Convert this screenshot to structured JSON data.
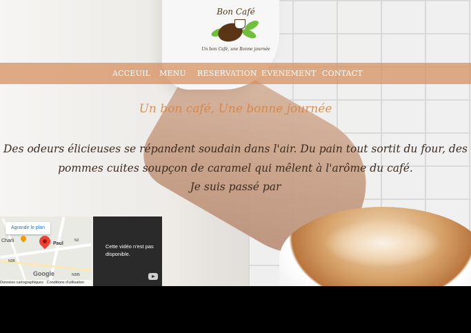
{
  "logo": {
    "title": "Bon Café",
    "subtitle": "Un bon Café, une Bonne journée"
  },
  "nav": {
    "items": [
      {
        "label": "ACCEUIL"
      },
      {
        "label": "MENU"
      },
      {
        "label": "RESERVATION"
      },
      {
        "label": "EVENEMENT"
      },
      {
        "label": "CONTACT"
      }
    ]
  },
  "hero": {
    "tagline": "Un bon café, Une bonne journée",
    "paragraph": "Des odeurs élicieuses se répandent soudain dans l'air. Du pain tout sortit du four, des pommes cuites soupçon de caramel qui mêlent à l'arôme du café.",
    "paragraph2": "Je suis passé par"
  },
  "map": {
    "enlarge_button": "Agrandir le plan",
    "place_label": "Paul",
    "nearby_label": "Charli",
    "road_1": "N2",
    "road_2": "N285",
    "road_3": "N2B",
    "footer_left": "Données cartographiques",
    "footer_right": "Conditions d'utilisation",
    "brand": "Google"
  },
  "video": {
    "message": "Cette vidéo n'est pas disponible."
  },
  "colors": {
    "nav_bar": "#d68c5a",
    "tagline": "#d6823f",
    "body_text": "#3b2a1e"
  }
}
